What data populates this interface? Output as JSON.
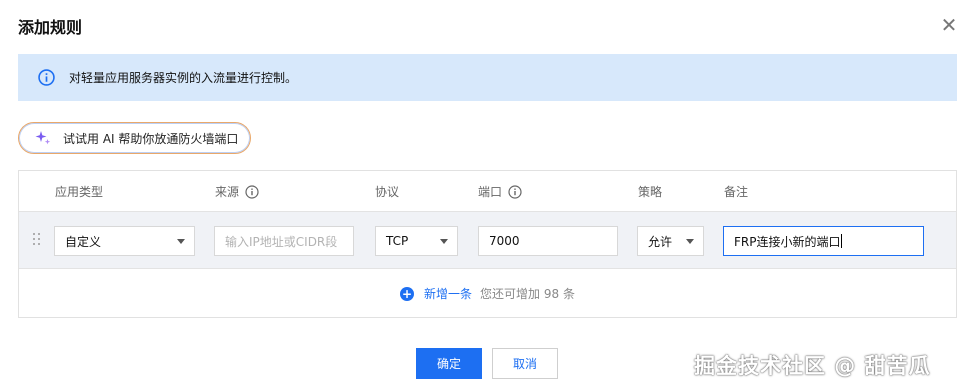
{
  "dialog": {
    "title": "添加规则",
    "close_icon": "close-icon"
  },
  "info_banner": {
    "icon": "info-icon",
    "text": "对轻量应用服务器实例的入流量进行控制。"
  },
  "ai_button": {
    "icon": "sparkle-icon",
    "label": "试试用 AI 帮助你放通防火墙端口"
  },
  "table": {
    "headers": {
      "app_type": "应用类型",
      "source": "来源",
      "protocol": "协议",
      "port": "端口",
      "policy": "策略",
      "remark": "备注"
    },
    "rows": [
      {
        "app_type": "自定义",
        "source_placeholder": "输入IP地址或CIDR段",
        "source_value": "",
        "protocol": "TCP",
        "port": "7000",
        "policy": "允许",
        "remark": "FRP连接小新的端口"
      }
    ],
    "add_row": {
      "label": "新增一条",
      "hint": "您还可增加 98 条"
    }
  },
  "footer": {
    "confirm_label": "确定",
    "cancel_label": "取消"
  },
  "watermark": "掘金技术社区 @ 甜苦瓜",
  "colors": {
    "accent": "#1d6ff2",
    "banner_bg": "#d7e8fb",
    "row_bg": "#f0f2f6"
  }
}
